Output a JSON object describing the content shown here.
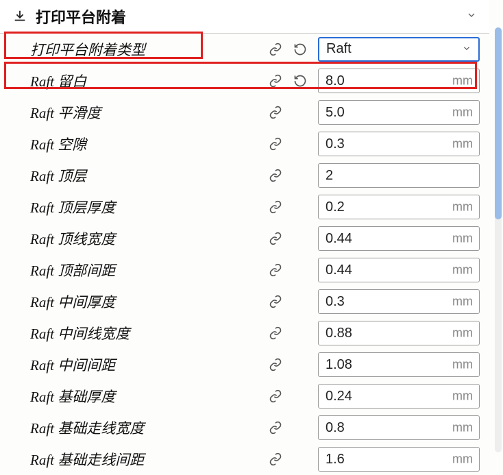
{
  "header": {
    "title": "打印平台附着"
  },
  "rows": [
    {
      "label": "打印平台附着类型",
      "value": "Raft",
      "unit": "",
      "type": "select",
      "hasReset": true
    },
    {
      "label": "Raft 留白",
      "value": "8.0",
      "unit": "mm",
      "type": "text",
      "hasReset": true
    },
    {
      "label": "Raft 平滑度",
      "value": "5.0",
      "unit": "mm",
      "type": "text",
      "hasReset": false
    },
    {
      "label": "Raft 空隙",
      "value": "0.3",
      "unit": "mm",
      "type": "text",
      "hasReset": false
    },
    {
      "label": "Raft 顶层",
      "value": "2",
      "unit": "",
      "type": "text",
      "hasReset": false
    },
    {
      "label": "Raft 顶层厚度",
      "value": "0.2",
      "unit": "mm",
      "type": "text",
      "hasReset": false
    },
    {
      "label": "Raft 顶线宽度",
      "value": "0.44",
      "unit": "mm",
      "type": "text",
      "hasReset": false
    },
    {
      "label": "Raft 顶部间距",
      "value": "0.44",
      "unit": "mm",
      "type": "text",
      "hasReset": false
    },
    {
      "label": "Raft 中间厚度",
      "value": "0.3",
      "unit": "mm",
      "type": "text",
      "hasReset": false
    },
    {
      "label": "Raft 中间线宽度",
      "value": "0.88",
      "unit": "mm",
      "type": "text",
      "hasReset": false
    },
    {
      "label": "Raft 中间间距",
      "value": "1.08",
      "unit": "mm",
      "type": "text",
      "hasReset": false
    },
    {
      "label": "Raft 基础厚度",
      "value": "0.24",
      "unit": "mm",
      "type": "text",
      "hasReset": false
    },
    {
      "label": "Raft 基础走线宽度",
      "value": "0.8",
      "unit": "mm",
      "type": "text",
      "hasReset": false
    },
    {
      "label": "Raft 基础走线间距",
      "value": "1.6",
      "unit": "mm",
      "type": "text",
      "hasReset": false
    }
  ]
}
